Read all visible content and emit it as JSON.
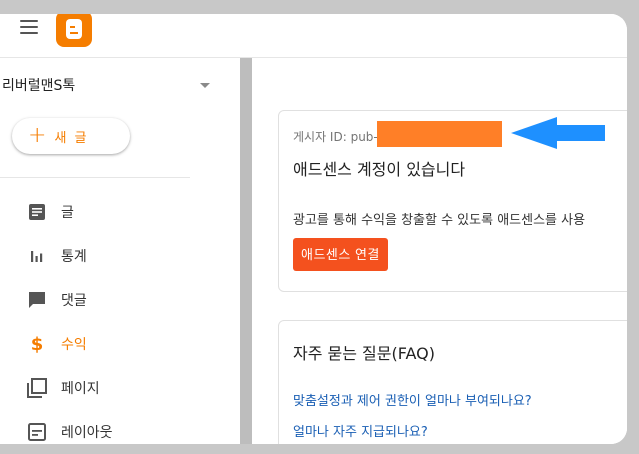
{
  "header": {
    "menu_icon": "hamburger-menu-icon",
    "logo_icon": "blogger-logo-icon",
    "brand_color": "#f57d00"
  },
  "sidebar": {
    "blog_name": "리버럴맨S톡",
    "new_post_label": "새 글",
    "items": [
      {
        "label": "글",
        "icon": "posts-icon"
      },
      {
        "label": "통계",
        "icon": "stats-icon"
      },
      {
        "label": "댓글",
        "icon": "comments-icon"
      },
      {
        "label": "수익",
        "icon": "dollar-icon",
        "active": true
      },
      {
        "label": "페이지",
        "icon": "pages-icon"
      },
      {
        "label": "레이아웃",
        "icon": "layout-icon"
      }
    ]
  },
  "adsense_card": {
    "publisher_label": "게시자 ID: pub-",
    "title": "애드센스 계정이 있습니다",
    "description": "광고를 통해 수익을 창출할 수 있도록 애드센스를 사용",
    "connect_label": "애드센스 연결",
    "redaction_color": "#ff7f27",
    "arrow_color": "#1e90ff"
  },
  "faq_card": {
    "title": "자주 묻는 질문(FAQ)",
    "links": [
      "맞춤설정과 제어 권한이 얼마나 부여되나요?",
      "얼마나 자주 지급되나요?"
    ]
  }
}
